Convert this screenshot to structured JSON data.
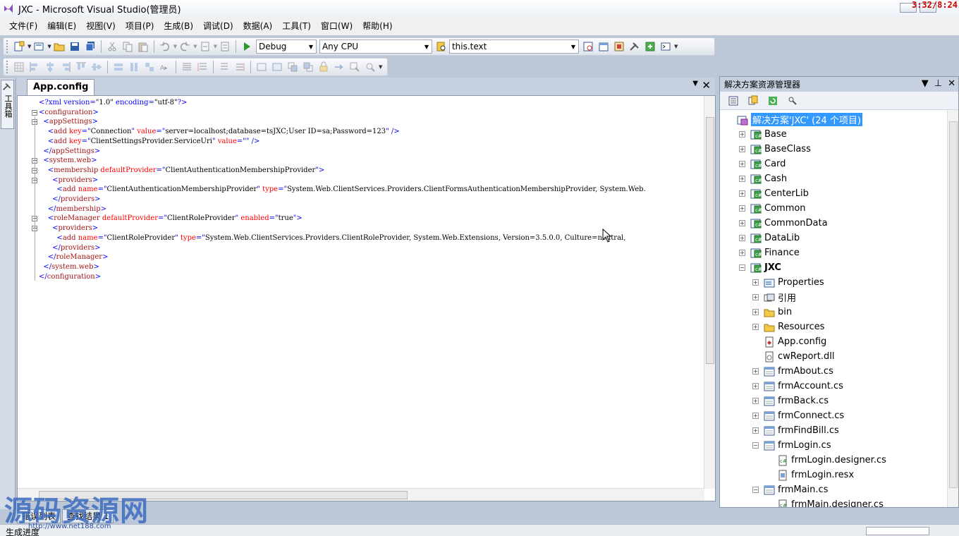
{
  "window": {
    "title": "JXC - Microsoft Visual Studio(管理员)",
    "clock": "3:32/8:24"
  },
  "menu": [
    "文件(F)",
    "编辑(E)",
    "视图(V)",
    "项目(P)",
    "生成(B)",
    "调试(D)",
    "数据(A)",
    "工具(T)",
    "窗口(W)",
    "帮助(H)"
  ],
  "toolbar": {
    "config": "Debug",
    "platform": "Any CPU",
    "find": "this.text"
  },
  "toolbox_label": "工具箱",
  "editor": {
    "tab": "App.config",
    "lines": [
      [
        [
          "c-blue",
          "<?xml version="
        ],
        [
          "c-black",
          "\"1.0\""
        ],
        [
          "c-blue",
          " encoding="
        ],
        [
          "c-black",
          "\"utf-8\""
        ],
        [
          "c-blue",
          "?>"
        ]
      ],
      [
        [
          "c-blue",
          "<"
        ],
        [
          "c-maroon",
          "configuration"
        ],
        [
          "c-blue",
          ">"
        ]
      ],
      [
        [
          "c-blue",
          "  <"
        ],
        [
          "c-maroon",
          "appSettings"
        ],
        [
          "c-blue",
          ">"
        ]
      ],
      [
        [
          "c-blue",
          "    <"
        ],
        [
          "c-maroon",
          "add"
        ],
        [
          "c-red",
          " key"
        ],
        [
          "c-blue",
          "=\""
        ],
        [
          "c-black",
          "Connection"
        ],
        [
          "c-blue",
          "\""
        ],
        [
          "c-red",
          " value"
        ],
        [
          "c-blue",
          "=\""
        ],
        [
          "c-black",
          "server=localhost;database=tsJXC;User ID=sa;Password=123"
        ],
        [
          "c-blue",
          "\" />"
        ]
      ],
      [
        [
          "c-blue",
          "    <"
        ],
        [
          "c-maroon",
          "add"
        ],
        [
          "c-red",
          " key"
        ],
        [
          "c-blue",
          "=\""
        ],
        [
          "c-black",
          "ClientSettingsProvider.ServiceUri"
        ],
        [
          "c-blue",
          "\""
        ],
        [
          "c-red",
          " value"
        ],
        [
          "c-blue",
          "=\"\" />"
        ]
      ],
      [
        [
          "c-blue",
          "  </"
        ],
        [
          "c-maroon",
          "appSettings"
        ],
        [
          "c-blue",
          ">"
        ]
      ],
      [
        [
          "c-blue",
          "  <"
        ],
        [
          "c-maroon",
          "system.web"
        ],
        [
          "c-blue",
          ">"
        ]
      ],
      [
        [
          "c-blue",
          "    <"
        ],
        [
          "c-maroon",
          "membership"
        ],
        [
          "c-red",
          " defaultProvider"
        ],
        [
          "c-blue",
          "=\""
        ],
        [
          "c-black",
          "ClientAuthenticationMembershipProvider"
        ],
        [
          "c-blue",
          "\">"
        ]
      ],
      [
        [
          "c-blue",
          "      <"
        ],
        [
          "c-maroon",
          "providers"
        ],
        [
          "c-blue",
          ">"
        ]
      ],
      [
        [
          "c-blue",
          "        <"
        ],
        [
          "c-maroon",
          "add"
        ],
        [
          "c-red",
          " name"
        ],
        [
          "c-blue",
          "=\""
        ],
        [
          "c-black",
          "ClientAuthenticationMembershipProvider"
        ],
        [
          "c-blue",
          "\""
        ],
        [
          "c-red",
          " type"
        ],
        [
          "c-blue",
          "=\""
        ],
        [
          "c-black",
          "System.Web.ClientServices.Providers.ClientFormsAuthenticationMembershipProvider, System.Web."
        ]
      ],
      [
        [
          "c-blue",
          "      </"
        ],
        [
          "c-maroon",
          "providers"
        ],
        [
          "c-blue",
          ">"
        ]
      ],
      [
        [
          "c-blue",
          "    </"
        ],
        [
          "c-maroon",
          "membership"
        ],
        [
          "c-blue",
          ">"
        ]
      ],
      [
        [
          "c-blue",
          "    <"
        ],
        [
          "c-maroon",
          "roleManager"
        ],
        [
          "c-red",
          " defaultProvider"
        ],
        [
          "c-blue",
          "=\""
        ],
        [
          "c-black",
          "ClientRoleProvider"
        ],
        [
          "c-blue",
          "\""
        ],
        [
          "c-red",
          " enabled"
        ],
        [
          "c-blue",
          "=\""
        ],
        [
          "c-black",
          "true"
        ],
        [
          "c-blue",
          "\">"
        ]
      ],
      [
        [
          "c-blue",
          "      <"
        ],
        [
          "c-maroon",
          "providers"
        ],
        [
          "c-blue",
          ">"
        ]
      ],
      [
        [
          "c-blue",
          "        <"
        ],
        [
          "c-maroon",
          "add"
        ],
        [
          "c-red",
          " name"
        ],
        [
          "c-blue",
          "=\""
        ],
        [
          "c-black",
          "ClientRoleProvider"
        ],
        [
          "c-blue",
          "\""
        ],
        [
          "c-red",
          " type"
        ],
        [
          "c-blue",
          "=\""
        ],
        [
          "c-black",
          "System.Web.ClientServices.Providers.ClientRoleProvider, System.Web.Extensions, Version=3.5.0.0, Culture=neutral,"
        ]
      ],
      [
        [
          "c-blue",
          "      </"
        ],
        [
          "c-maroon",
          "providers"
        ],
        [
          "c-blue",
          ">"
        ]
      ],
      [
        [
          "c-blue",
          "    </"
        ],
        [
          "c-maroon",
          "roleManager"
        ],
        [
          "c-blue",
          ">"
        ]
      ],
      [
        [
          "c-blue",
          "  </"
        ],
        [
          "c-maroon",
          "system.web"
        ],
        [
          "c-blue",
          ">"
        ]
      ],
      [
        [
          "c-blue",
          "</"
        ],
        [
          "c-maroon",
          "configuration"
        ],
        [
          "c-blue",
          ">"
        ]
      ]
    ]
  },
  "bottom_tabs": [
    "错误列表",
    "查找结果 1"
  ],
  "status": "生成进度",
  "watermark": {
    "text": "源码资源网",
    "url": "http://www.net188.com"
  },
  "solution_explorer": {
    "title": "解决方案资源管理器",
    "items": [
      {
        "label": "解决方案'JXC' (24 个项目)",
        "icon": "solution-icon",
        "depth": 0,
        "expander": "",
        "kind": "root"
      },
      {
        "label": "Base",
        "icon": "csharp-project-icon",
        "depth": 1,
        "expander": "+"
      },
      {
        "label": "BaseClass",
        "icon": "csharp-project-icon",
        "depth": 1,
        "expander": "+"
      },
      {
        "label": "Card",
        "icon": "csharp-project-icon",
        "depth": 1,
        "expander": "+"
      },
      {
        "label": "Cash",
        "icon": "csharp-project-icon",
        "depth": 1,
        "expander": "+"
      },
      {
        "label": "CenterLib",
        "icon": "csharp-project-icon",
        "depth": 1,
        "expander": "+"
      },
      {
        "label": "Common",
        "icon": "csharp-project-icon",
        "depth": 1,
        "expander": "+"
      },
      {
        "label": "CommonData",
        "icon": "csharp-project-icon",
        "depth": 1,
        "expander": "+"
      },
      {
        "label": "DataLib",
        "icon": "csharp-project-icon",
        "depth": 1,
        "expander": "+"
      },
      {
        "label": "Finance",
        "icon": "csharp-project-icon",
        "depth": 1,
        "expander": "+"
      },
      {
        "label": "JXC",
        "icon": "csharp-project-icon",
        "depth": 1,
        "expander": "-",
        "kind": "bold"
      },
      {
        "label": "Properties",
        "icon": "properties-icon",
        "depth": 2,
        "expander": "+"
      },
      {
        "label": "引用",
        "icon": "references-icon",
        "depth": 2,
        "expander": "+"
      },
      {
        "label": "bin",
        "icon": "folder-icon",
        "depth": 2,
        "expander": "+"
      },
      {
        "label": "Resources",
        "icon": "folder-icon",
        "depth": 2,
        "expander": "+"
      },
      {
        "label": "App.config",
        "icon": "config-file-icon",
        "depth": 2,
        "expander": ""
      },
      {
        "label": "cwReport.dll",
        "icon": "dll-file-icon",
        "depth": 2,
        "expander": ""
      },
      {
        "label": "frmAbout.cs",
        "icon": "form-icon",
        "depth": 2,
        "expander": "+"
      },
      {
        "label": "frmAccount.cs",
        "icon": "form-icon",
        "depth": 2,
        "expander": "+"
      },
      {
        "label": "frmBack.cs",
        "icon": "form-icon",
        "depth": 2,
        "expander": "+"
      },
      {
        "label": "frmConnect.cs",
        "icon": "form-icon",
        "depth": 2,
        "expander": "+"
      },
      {
        "label": "frmFindBill.cs",
        "icon": "form-icon",
        "depth": 2,
        "expander": "+"
      },
      {
        "label": "frmLogin.cs",
        "icon": "form-icon",
        "depth": 2,
        "expander": "-"
      },
      {
        "label": "frmLogin.designer.cs",
        "icon": "cs-file-icon",
        "depth": 3,
        "expander": ""
      },
      {
        "label": "frmLogin.resx",
        "icon": "resx-file-icon",
        "depth": 3,
        "expander": ""
      },
      {
        "label": "frmMain.cs",
        "icon": "form-icon",
        "depth": 2,
        "expander": "-"
      },
      {
        "label": "frmMain.designer.cs",
        "icon": "cs-file-icon",
        "depth": 3,
        "expander": ""
      }
    ]
  },
  "colors": {
    "selection": "#3399ff",
    "xml_delimiter": "#0000ff",
    "xml_element": "#a31515",
    "xml_attribute": "#ff0000",
    "watermark": "#3b6cc0",
    "clock": "#d40000"
  }
}
